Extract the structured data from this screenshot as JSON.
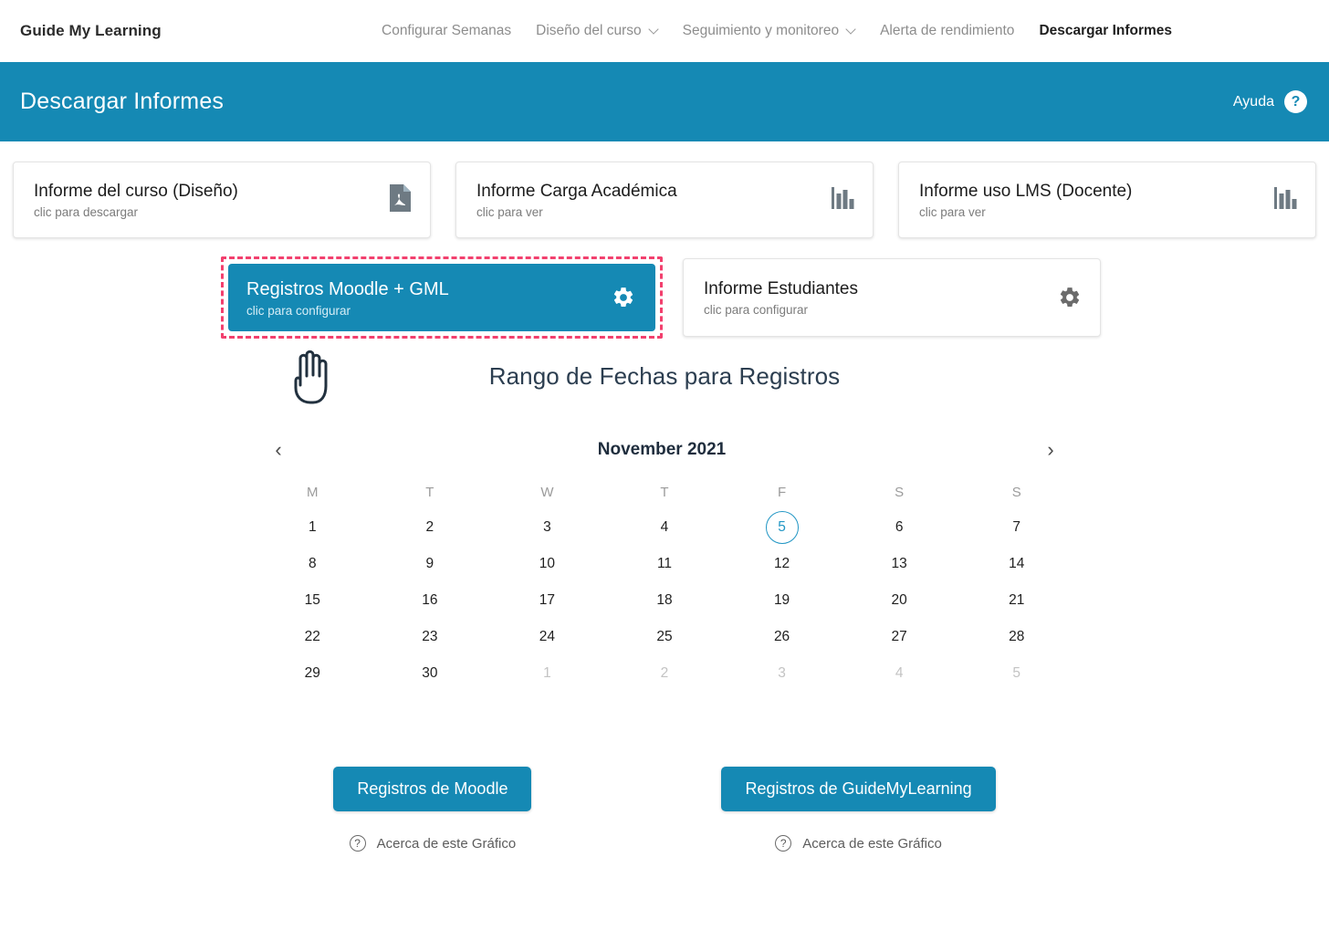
{
  "brand": "Guide My Learning",
  "nav": {
    "items": [
      {
        "label": "Configurar Semanas",
        "caret": false,
        "active": false
      },
      {
        "label": "Diseño del curso",
        "caret": true,
        "active": false
      },
      {
        "label": "Seguimiento y monitoreo",
        "caret": true,
        "active": false
      },
      {
        "label": "Alerta de rendimiento",
        "caret": false,
        "active": false
      },
      {
        "label": "Descargar Informes",
        "caret": false,
        "active": true
      }
    ]
  },
  "pagehead": {
    "title": "Descargar Informes",
    "help_label": "Ayuda",
    "help_icon": "question-circle-icon",
    "background": "#1589b4"
  },
  "cards_row1": [
    {
      "title": "Informe del curso (Diseño)",
      "subtitle": "clic para descargar",
      "icon": "pdf-file-icon"
    },
    {
      "title": "Informe Carga Académica",
      "subtitle": "clic para ver",
      "icon": "bar-chart-icon"
    },
    {
      "title": "Informe uso LMS (Docente)",
      "subtitle": "clic para ver",
      "icon": "bar-chart-icon"
    }
  ],
  "cards_row2": [
    {
      "title": "Registros Moodle + GML",
      "subtitle": "clic para configurar",
      "icon": "gear-icon",
      "selected": true,
      "highlight_color": "#f2406e"
    },
    {
      "title": "Informe Estudiantes",
      "subtitle": "clic para configurar",
      "icon": "gear-icon",
      "selected": false
    }
  ],
  "cursor": {
    "icon": "pointing-hand-cursor"
  },
  "section": {
    "title": "Rango de Fechas para Registros"
  },
  "calendar": {
    "month_label": "November 2021",
    "prev_icon": "chevron-left-icon",
    "next_icon": "chevron-right-icon",
    "day_headers": [
      "M",
      "T",
      "W",
      "T",
      "F",
      "S",
      "S"
    ],
    "selected_day": 5,
    "selected_color": "#2196c4",
    "weeks": [
      [
        {
          "n": "1",
          "muted": false
        },
        {
          "n": "2",
          "muted": false
        },
        {
          "n": "3",
          "muted": false
        },
        {
          "n": "4",
          "muted": false
        },
        {
          "n": "5",
          "muted": false,
          "today": true
        },
        {
          "n": "6",
          "muted": false
        },
        {
          "n": "7",
          "muted": false
        }
      ],
      [
        {
          "n": "8",
          "muted": false
        },
        {
          "n": "9",
          "muted": false
        },
        {
          "n": "10",
          "muted": false
        },
        {
          "n": "11",
          "muted": false
        },
        {
          "n": "12",
          "muted": false
        },
        {
          "n": "13",
          "muted": false
        },
        {
          "n": "14",
          "muted": false
        }
      ],
      [
        {
          "n": "15",
          "muted": false
        },
        {
          "n": "16",
          "muted": false
        },
        {
          "n": "17",
          "muted": false
        },
        {
          "n": "18",
          "muted": false
        },
        {
          "n": "19",
          "muted": false
        },
        {
          "n": "20",
          "muted": false
        },
        {
          "n": "21",
          "muted": false
        }
      ],
      [
        {
          "n": "22",
          "muted": false
        },
        {
          "n": "23",
          "muted": false
        },
        {
          "n": "24",
          "muted": false
        },
        {
          "n": "25",
          "muted": false
        },
        {
          "n": "26",
          "muted": false
        },
        {
          "n": "27",
          "muted": false
        },
        {
          "n": "28",
          "muted": false
        }
      ],
      [
        {
          "n": "29",
          "muted": false
        },
        {
          "n": "30",
          "muted": false
        },
        {
          "n": "1",
          "muted": true
        },
        {
          "n": "2",
          "muted": true
        },
        {
          "n": "3",
          "muted": true
        },
        {
          "n": "4",
          "muted": true
        },
        {
          "n": "5",
          "muted": true
        }
      ]
    ]
  },
  "actions": [
    {
      "button_label": "Registros de Moodle",
      "about_label": "Acerca de este Gráfico",
      "about_icon": "question-circle-icon"
    },
    {
      "button_label": "Registros de GuideMyLearning",
      "about_label": "Acerca de este Gráfico",
      "about_icon": "question-circle-icon"
    }
  ]
}
